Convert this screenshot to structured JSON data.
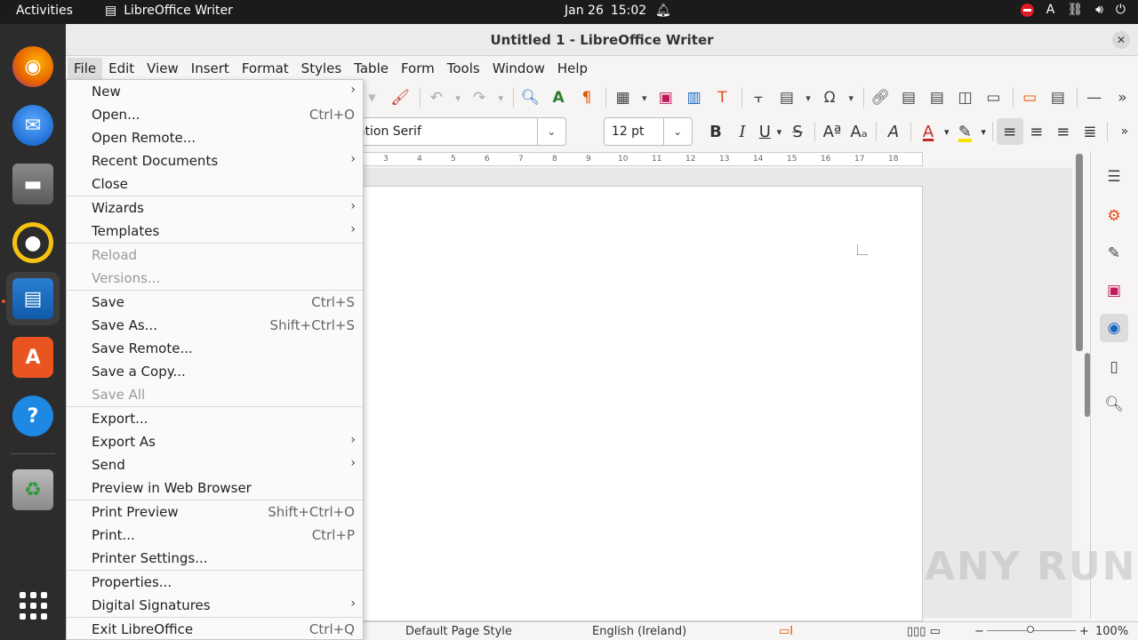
{
  "topbar": {
    "activities": "Activities",
    "app_name": "LibreOffice Writer",
    "date": "Jan 26",
    "time": "15:02",
    "lang": "A"
  },
  "window": {
    "title": "Untitled 1 - LibreOffice Writer"
  },
  "menubar": [
    "File",
    "Edit",
    "View",
    "Insert",
    "Format",
    "Styles",
    "Table",
    "Form",
    "Tools",
    "Window",
    "Help"
  ],
  "toolbar2": {
    "font_name": "Liberation Serif",
    "font_size": "12 pt"
  },
  "ruler_ticks": [
    "3",
    "4",
    "5",
    "6",
    "7",
    "8",
    "9",
    "10",
    "11",
    "12",
    "13",
    "14",
    "15",
    "16",
    "17",
    "18"
  ],
  "statusbar": {
    "page_style": "Default Page Style",
    "language": "English (Ireland)",
    "zoom": "100%"
  },
  "file_menu": {
    "items": [
      {
        "label": "New",
        "shortcut": "",
        "submenu": true,
        "disabled": false
      },
      {
        "label": "Open...",
        "shortcut": "Ctrl+O",
        "submenu": false,
        "disabled": false
      },
      {
        "label": "Open Remote...",
        "shortcut": "",
        "submenu": false,
        "disabled": false
      },
      {
        "label": "Recent Documents",
        "shortcut": "",
        "submenu": true,
        "disabled": false
      },
      {
        "label": "Close",
        "shortcut": "",
        "submenu": false,
        "disabled": false
      },
      {
        "label": "Wizards",
        "shortcut": "",
        "submenu": true,
        "disabled": false
      },
      {
        "label": "Templates",
        "shortcut": "",
        "submenu": true,
        "disabled": false
      },
      {
        "label": "Reload",
        "shortcut": "",
        "submenu": false,
        "disabled": true
      },
      {
        "label": "Versions...",
        "shortcut": "",
        "submenu": false,
        "disabled": true
      },
      {
        "label": "Save",
        "shortcut": "Ctrl+S",
        "submenu": false,
        "disabled": false
      },
      {
        "label": "Save As...",
        "shortcut": "Shift+Ctrl+S",
        "submenu": false,
        "disabled": false
      },
      {
        "label": "Save Remote...",
        "shortcut": "",
        "submenu": false,
        "disabled": false
      },
      {
        "label": "Save a Copy...",
        "shortcut": "",
        "submenu": false,
        "disabled": false
      },
      {
        "label": "Save All",
        "shortcut": "",
        "submenu": false,
        "disabled": true
      },
      {
        "label": "Export...",
        "shortcut": "",
        "submenu": false,
        "disabled": false
      },
      {
        "label": "Export As",
        "shortcut": "",
        "submenu": true,
        "disabled": false
      },
      {
        "label": "Send",
        "shortcut": "",
        "submenu": true,
        "disabled": false
      },
      {
        "label": "Preview in Web Browser",
        "shortcut": "",
        "submenu": false,
        "disabled": false
      },
      {
        "label": "Print Preview",
        "shortcut": "Shift+Ctrl+O",
        "submenu": false,
        "disabled": false
      },
      {
        "label": "Print...",
        "shortcut": "Ctrl+P",
        "submenu": false,
        "disabled": false
      },
      {
        "label": "Printer Settings...",
        "shortcut": "",
        "submenu": false,
        "disabled": false
      },
      {
        "label": "Properties...",
        "shortcut": "",
        "submenu": false,
        "disabled": false
      },
      {
        "label": "Digital Signatures",
        "shortcut": "",
        "submenu": true,
        "disabled": false
      },
      {
        "label": "Exit LibreOffice",
        "shortcut": "Ctrl+Q",
        "submenu": false,
        "disabled": false
      }
    ]
  },
  "watermark": "ANY RUN"
}
